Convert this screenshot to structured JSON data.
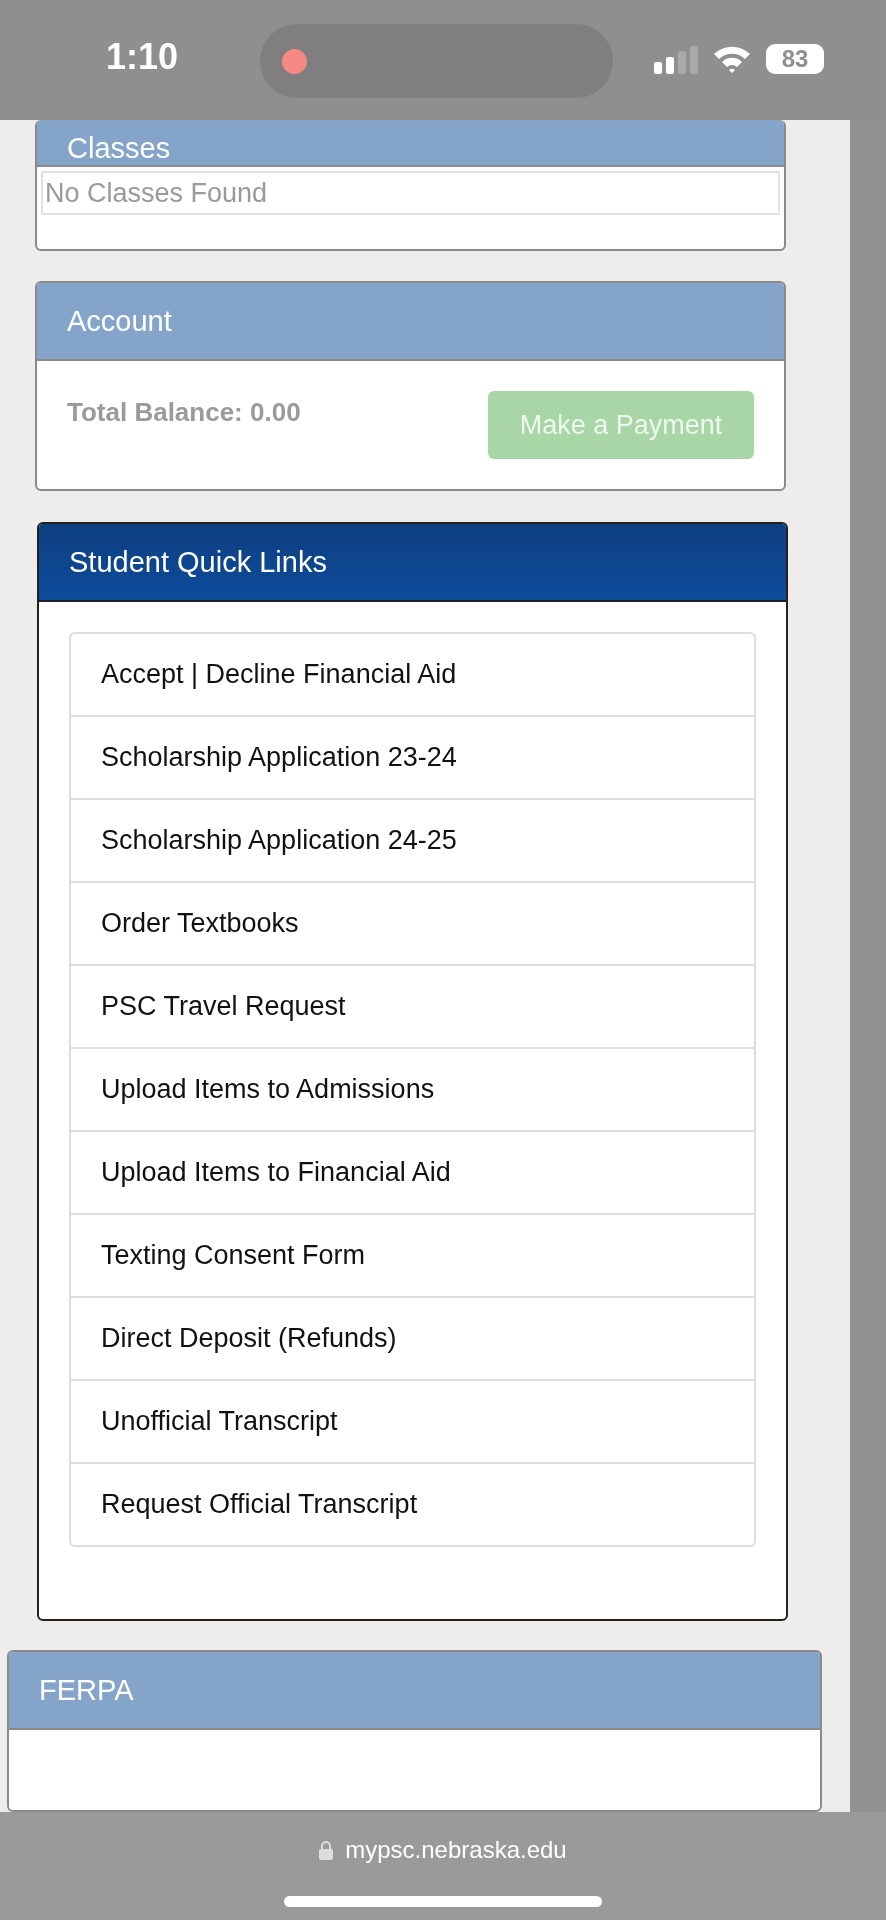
{
  "status_bar": {
    "time": "1:10",
    "battery": "83"
  },
  "classes": {
    "title": "Classes",
    "empty_text": "No Classes Found"
  },
  "account": {
    "title": "Account",
    "balance": "Total Balance: 0.00",
    "button": "Make a Payment"
  },
  "quick_links": {
    "title": "Student Quick Links",
    "links": [
      "Accept | Decline Financial Aid",
      "Scholarship Application 23-24",
      "Scholarship Application 24-25",
      "Order Textbooks",
      "PSC Travel Request",
      "Upload Items to Admissions",
      "Upload Items to Financial Aid",
      "Texting Consent Form",
      "Direct Deposit (Refunds)",
      "Unofficial Transcript",
      "Request Official Transcript"
    ]
  },
  "ferpa": {
    "title": "FERPA"
  },
  "address_bar": {
    "url": "mypsc.nebraska.edu"
  }
}
